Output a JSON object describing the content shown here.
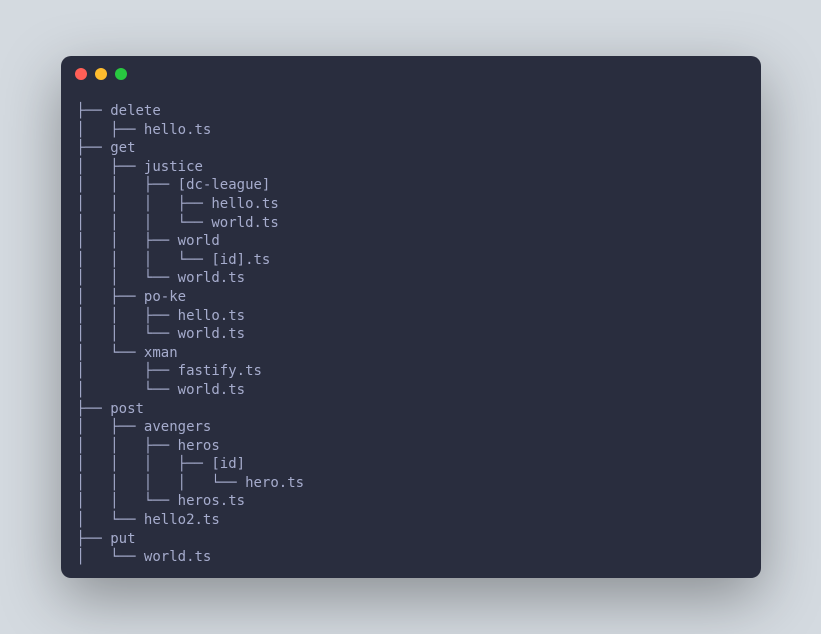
{
  "window": {
    "traffic_lights": [
      "close",
      "minimize",
      "maximize"
    ]
  },
  "tree": {
    "lines": [
      "├── delete",
      "│   ├── hello.ts",
      "├── get",
      "│   ├── justice",
      "│   │   ├── [dc-league]",
      "│   │   │   ├── hello.ts",
      "│   │   │   └── world.ts",
      "│   │   ├── world",
      "│   │   │   └── [id].ts",
      "│   │   └── world.ts",
      "│   ├── po-ke",
      "│   │   ├── hello.ts",
      "│   │   └── world.ts",
      "│   └── xman",
      "│       ├── fastify.ts",
      "│       └── world.ts",
      "├── post",
      "│   ├── avengers",
      "│   │   ├── heros",
      "│   │   │   ├── [id]",
      "│   │   │   │   └── hero.ts",
      "│   │   └── heros.ts",
      "│   └── hello2.ts",
      "├── put",
      "│   └── world.ts"
    ]
  }
}
